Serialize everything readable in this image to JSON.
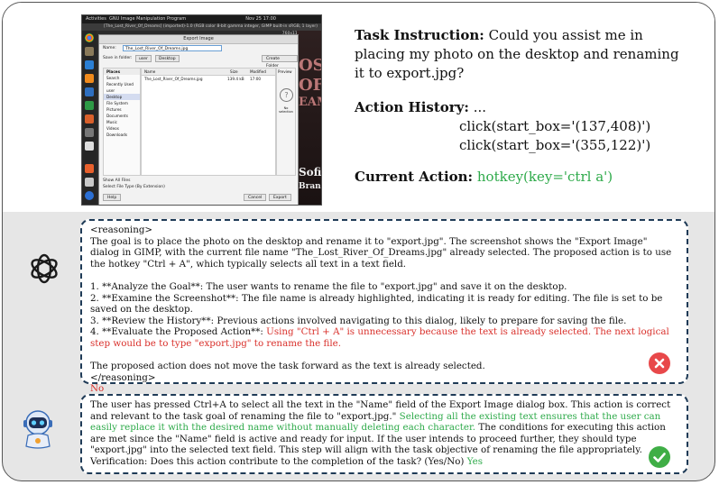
{
  "screenshot": {
    "topbar": {
      "activities": "Activities",
      "app": "GNU Image Manipulation Program",
      "clock": "Nov 25  17:00"
    },
    "window_title": "[The_Lost_River_Of_Dreams] (imported)-1.0 (RGB color 8-bit gamma integer, GIMP built-in sRGB, 1 layer) 760x1140 – GIMP",
    "dialog": {
      "title": "Export Image",
      "name_label": "Name:",
      "name_value": "The_Lost_River_Of_Dreams.jpg",
      "save_in_label": "Save in folder:",
      "path_buttons": [
        "user",
        "Desktop"
      ],
      "create_folder": "Create Folder",
      "places_header": "Places",
      "places": [
        "Search",
        "Recently Used",
        "user",
        "Desktop",
        "File System",
        "Pictures",
        "Documents",
        "Music",
        "Videos",
        "Downloads"
      ],
      "columns": [
        "Name",
        "Size",
        "Modified"
      ],
      "files": [
        {
          "name": "The_Lost_River_Of_Dreams.jpg",
          "size": "139.4 kB",
          "modified": "17:00"
        }
      ],
      "preview_header": "Preview",
      "no_selection": "No selection",
      "show_all_files": "Show All Files",
      "select_file_type": "Select File Type (By Extension)",
      "help": "Help",
      "cancel": "Cancel",
      "export": "Export"
    },
    "bg_text": [
      "OST",
      "OF",
      "EAMS",
      "Sofia",
      "Brand"
    ]
  },
  "task": {
    "instruction_label": "Task Instruction:",
    "instruction_text": "Could you assist me in placing my photo on the desktop and renaming it to export.jpg?",
    "history_label": "Action History:",
    "history_ellipsis": "...",
    "history": [
      "click(start_box='(137,408)')",
      "click(start_box='(355,122)')"
    ],
    "current_label": "Current Action:",
    "current_action": "hotkey(key='ctrl a')"
  },
  "reasoning_box": {
    "open_tag": "<reasoning>",
    "intro": "The goal is to place the photo on the desktop and rename it to \"export.jpg\". The screenshot shows the \"Export Image\" dialog in GIMP, with the current file name \"The_Lost_River_Of_Dreams.jpg\" already selected. The proposed action is to use the hotkey \"Ctrl + A\", which typically selects all text in a text field.",
    "steps": [
      "1. **Analyze the Goal**: The user wants to rename the file to \"export.jpg\" and save it on the desktop.",
      "2. **Examine the Screenshot**: The file name is already highlighted, indicating it is ready for editing. The file is set to be saved on the desktop.",
      "3. **Review the History**: Previous actions involved navigating to this dialog, likely to prepare for saving the file."
    ],
    "step4_prefix": "4. **Evaluate the Proposed Action**: ",
    "step4_red": "Using \"Ctrl + A\" is unnecessary because the text is already selected. The next logical step would be to type \"export.jpg\" to rename the file.",
    "conclusion": "The proposed action does not move the task forward as the text is already selected.",
    "close_tag": "</reasoning>",
    "verdict": "No"
  },
  "verify_box": {
    "text_a": "The user has pressed Ctrl+A to select all the text in the \"Name\" field of the Export Image dialog box. This action is correct and relevant to the task goal of renaming the file to \"export.jpg.\" ",
    "text_green": "Selecting all the existing text ensures that the user can easily replace it with the desired name without manually deleting each character.",
    "text_b": " The conditions for executing this action are met since the \"Name\" field is active and ready for input. If the user intends to proceed further, they should type \"export.jpg\" into the selected text field. This step will align with the task objective of renaming the file appropriately.",
    "question": "Verification: Does this action contribute to the completion of the task? (Yes/No)",
    "answer": "Yes"
  },
  "colors": {
    "green": "#2eaa4a",
    "red": "#d9302b",
    "border": "#1f3b57",
    "x_badge": "#e8484a",
    "check_badge": "#3fae46"
  }
}
